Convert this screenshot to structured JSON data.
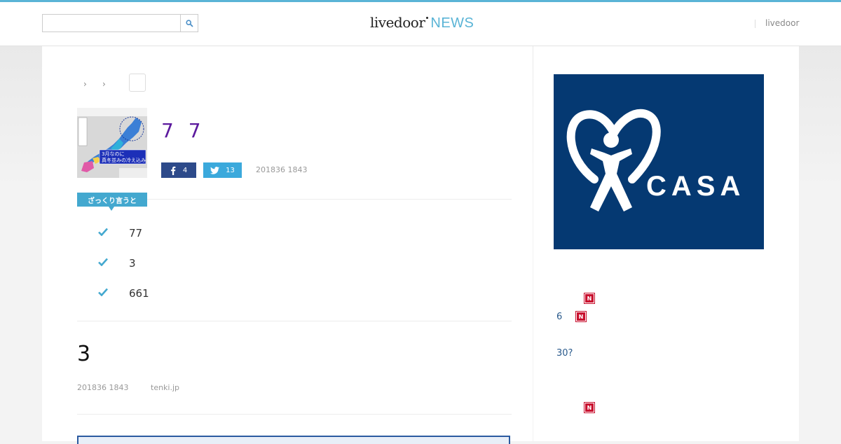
{
  "colors": {
    "accent": "#5ab4d6",
    "title": "#5c1a9e",
    "facebook": "#2d4a8a",
    "twitter": "#3ba9dc",
    "ad_bg": "#053972",
    "badge": "#c8102e"
  },
  "header": {
    "search_placeholder": "",
    "logo": {
      "main": "livedoor",
      "sub": "NEWS"
    },
    "link": "livedoor"
  },
  "breadcrumb": {
    "separators": [
      "›",
      "›"
    ]
  },
  "thumbnail": {
    "caption_lines": [
      "3月なのに",
      "真冬並みの冷え込み"
    ]
  },
  "article": {
    "title": "7 7",
    "share": {
      "facebook_count": "4",
      "twitter_count": "13"
    },
    "date": "201836 1843"
  },
  "summary": {
    "label": "ざっくり言うと",
    "items": [
      {
        "text": "77"
      },
      {
        "text": "3"
      },
      {
        "text": "661"
      }
    ]
  },
  "section": {
    "title": "3",
    "date": "201836 1843",
    "source": "tenki.jp"
  },
  "ad": {
    "brand": "CASA",
    "registered_mark": "®"
  },
  "sidebar": {
    "links": [
      {
        "text": "6",
        "badge": "N"
      },
      {
        "text": "30?"
      }
    ],
    "badges": [
      "N",
      "N"
    ]
  }
}
